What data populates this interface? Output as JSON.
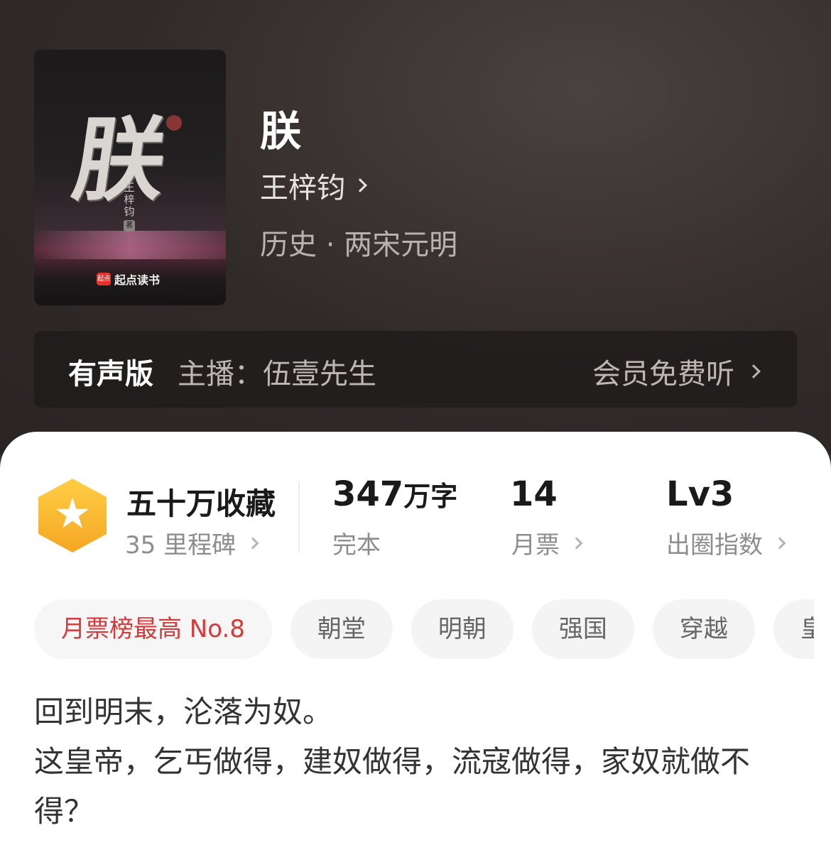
{
  "book": {
    "title": "朕",
    "author": "王梓钧",
    "category": "历史 · 两宋元明",
    "cover": {
      "glyph": "朕",
      "author_vertical": "王梓钧",
      "author_mark": "著",
      "brand_logo": "起点",
      "brand_name": "起点读书"
    }
  },
  "audio": {
    "label": "有声版",
    "narrator": "主播：伍壹先生",
    "cta": "会员免费听"
  },
  "stats": {
    "collect": {
      "main": "五十万收藏",
      "sub": "35 里程碑"
    },
    "words": {
      "number": "347",
      "unit": "万字",
      "sub": "完本"
    },
    "tickets": {
      "number": "14",
      "sub": "月票"
    },
    "influence": {
      "number": "Lv3",
      "sub": "出圈指数"
    }
  },
  "tags": [
    "月票榜最高 No.8",
    "朝堂",
    "明朝",
    "强国",
    "穿越",
    "皇"
  ],
  "description": [
    "回到明末，沦落为奴。",
    "这皇帝，乞丐做得，建奴做得，流寇做得，家奴就做不得？"
  ],
  "colors": {
    "header_bg": "#302a29",
    "accent_orange": "#f5a623",
    "rank_red": "#d73a3a",
    "text_dark": "#1a1a1a",
    "text_gray": "#8d8d8d"
  }
}
